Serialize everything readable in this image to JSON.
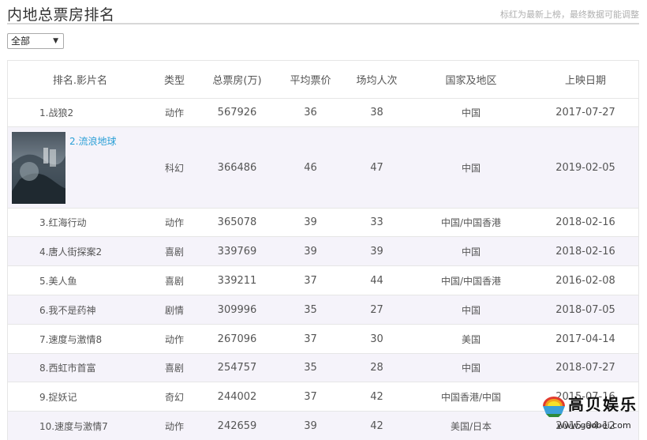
{
  "header": {
    "title": "内地总票房排名",
    "note": "标红为最新上榜，最终数据可能调整"
  },
  "filter": {
    "selected": "全部"
  },
  "table": {
    "columns": [
      "排名.影片名",
      "类型",
      "总票房(万)",
      "平均票价",
      "场均人次",
      "国家及地区",
      "上映日期"
    ],
    "rows": [
      {
        "name": "1.战狼2",
        "type": "动作",
        "box": "567926",
        "price": "36",
        "attendance": "38",
        "country": "中国",
        "date": "2017-07-27"
      },
      {
        "name": "2.流浪地球",
        "type": "科幻",
        "box": "366486",
        "price": "46",
        "attendance": "47",
        "country": "中国",
        "date": "2019-02-05",
        "featured": true
      },
      {
        "name": "3.红海行动",
        "type": "动作",
        "box": "365078",
        "price": "39",
        "attendance": "33",
        "country": "中国/中国香港",
        "date": "2018-02-16"
      },
      {
        "name": "4.唐人街探案2",
        "type": "喜剧",
        "box": "339769",
        "price": "39",
        "attendance": "39",
        "country": "中国",
        "date": "2018-02-16"
      },
      {
        "name": "5.美人鱼",
        "type": "喜剧",
        "box": "339211",
        "price": "37",
        "attendance": "44",
        "country": "中国/中国香港",
        "date": "2016-02-08"
      },
      {
        "name": "6.我不是药神",
        "type": "剧情",
        "box": "309996",
        "price": "35",
        "attendance": "27",
        "country": "中国",
        "date": "2018-07-05"
      },
      {
        "name": "7.速度与激情8",
        "type": "动作",
        "box": "267096",
        "price": "37",
        "attendance": "30",
        "country": "美国",
        "date": "2017-04-14"
      },
      {
        "name": "8.西虹市首富",
        "type": "喜剧",
        "box": "254757",
        "price": "35",
        "attendance": "28",
        "country": "中国",
        "date": "2018-07-27"
      },
      {
        "name": "9.捉妖记",
        "type": "奇幻",
        "box": "244002",
        "price": "37",
        "attendance": "42",
        "country": "中国香港/中国",
        "date": "2015-07-16"
      },
      {
        "name": "10.速度与激情7",
        "type": "动作",
        "box": "242659",
        "price": "39",
        "attendance": "42",
        "country": "美国/日本",
        "date": "2015-04-12"
      }
    ]
  },
  "watermark": {
    "brand": "高贝娱乐",
    "url": "www.gaobei.com"
  }
}
